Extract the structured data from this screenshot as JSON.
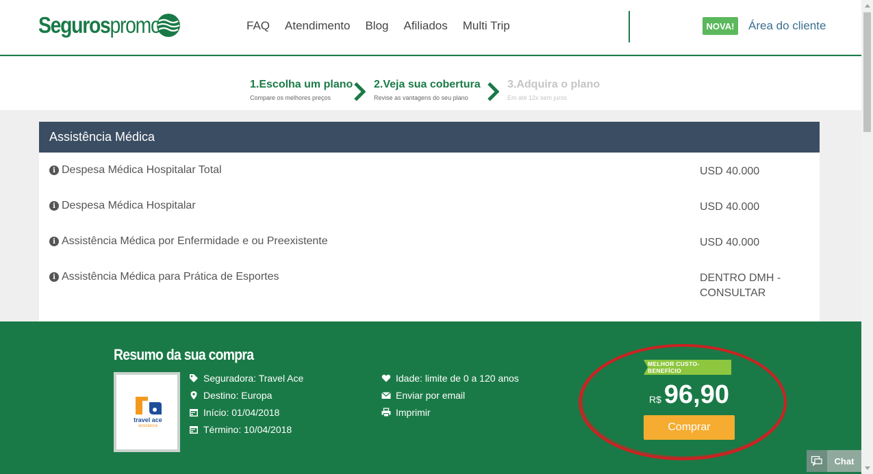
{
  "header": {
    "logo_bold": "Seguros",
    "logo_light": "promo",
    "nav": [
      "FAQ",
      "Atendimento",
      "Blog",
      "Afiliados",
      "Multi Trip"
    ],
    "badge_new": "NOVA!",
    "client_area": "Área do cliente"
  },
  "steps": [
    {
      "title": "1.Escolha um plano",
      "subtitle": "Compare os melhores preços",
      "active": true
    },
    {
      "title": "2.Veja sua cobertura",
      "subtitle": "Revise as vantagens do seu plano",
      "active": true
    },
    {
      "title": "3.Adquira o plano",
      "subtitle": "Em até 12x sem juros",
      "active": false
    }
  ],
  "coverage": {
    "heading": "Assistência Médica",
    "rows": [
      {
        "label": "Despesa Médica Hospitalar Total",
        "value": "USD 40.000"
      },
      {
        "label": "Despesa Médica Hospitalar",
        "value": "USD 40.000"
      },
      {
        "label": "Assistência Médica por Enfermidade e ou Preexistente",
        "value": "USD 40.000"
      },
      {
        "label": "Assistência Médica para Prática de Esportes",
        "value": "DENTRO DMH - CONSULTAR"
      }
    ]
  },
  "summary": {
    "title": "Resumo da sua compra",
    "brand_line1": "travel ace",
    "brand_line2": "assistance",
    "details": [
      {
        "icon": "tag-icon",
        "text": "Seguradora: Travel Ace"
      },
      {
        "icon": "map-pin-icon",
        "text": "Destino: Europa"
      },
      {
        "icon": "calendar-icon",
        "text": "Início: 01/04/2018"
      },
      {
        "icon": "calendar-icon",
        "text": "Término: 10/04/2018"
      }
    ],
    "extras": [
      {
        "icon": "heart-icon",
        "text": "Idade: limite de 0 a 120 anos"
      },
      {
        "icon": "envelope-icon",
        "text": "Enviar por email"
      },
      {
        "icon": "printer-icon",
        "text": "Imprimir"
      }
    ],
    "ribbon": "MELHOR CUSTO-BENEFÍCIO",
    "currency": "R$",
    "price": "96,90",
    "buy_label": "Comprar"
  },
  "chat": {
    "label": "Chat"
  },
  "colors": {
    "brand_green": "#1a7a47",
    "panel_header": "#3b4d63",
    "buy_button": "#f5ac31",
    "ribbon": "#8dc63f",
    "annotation_red": "#cc2222"
  }
}
